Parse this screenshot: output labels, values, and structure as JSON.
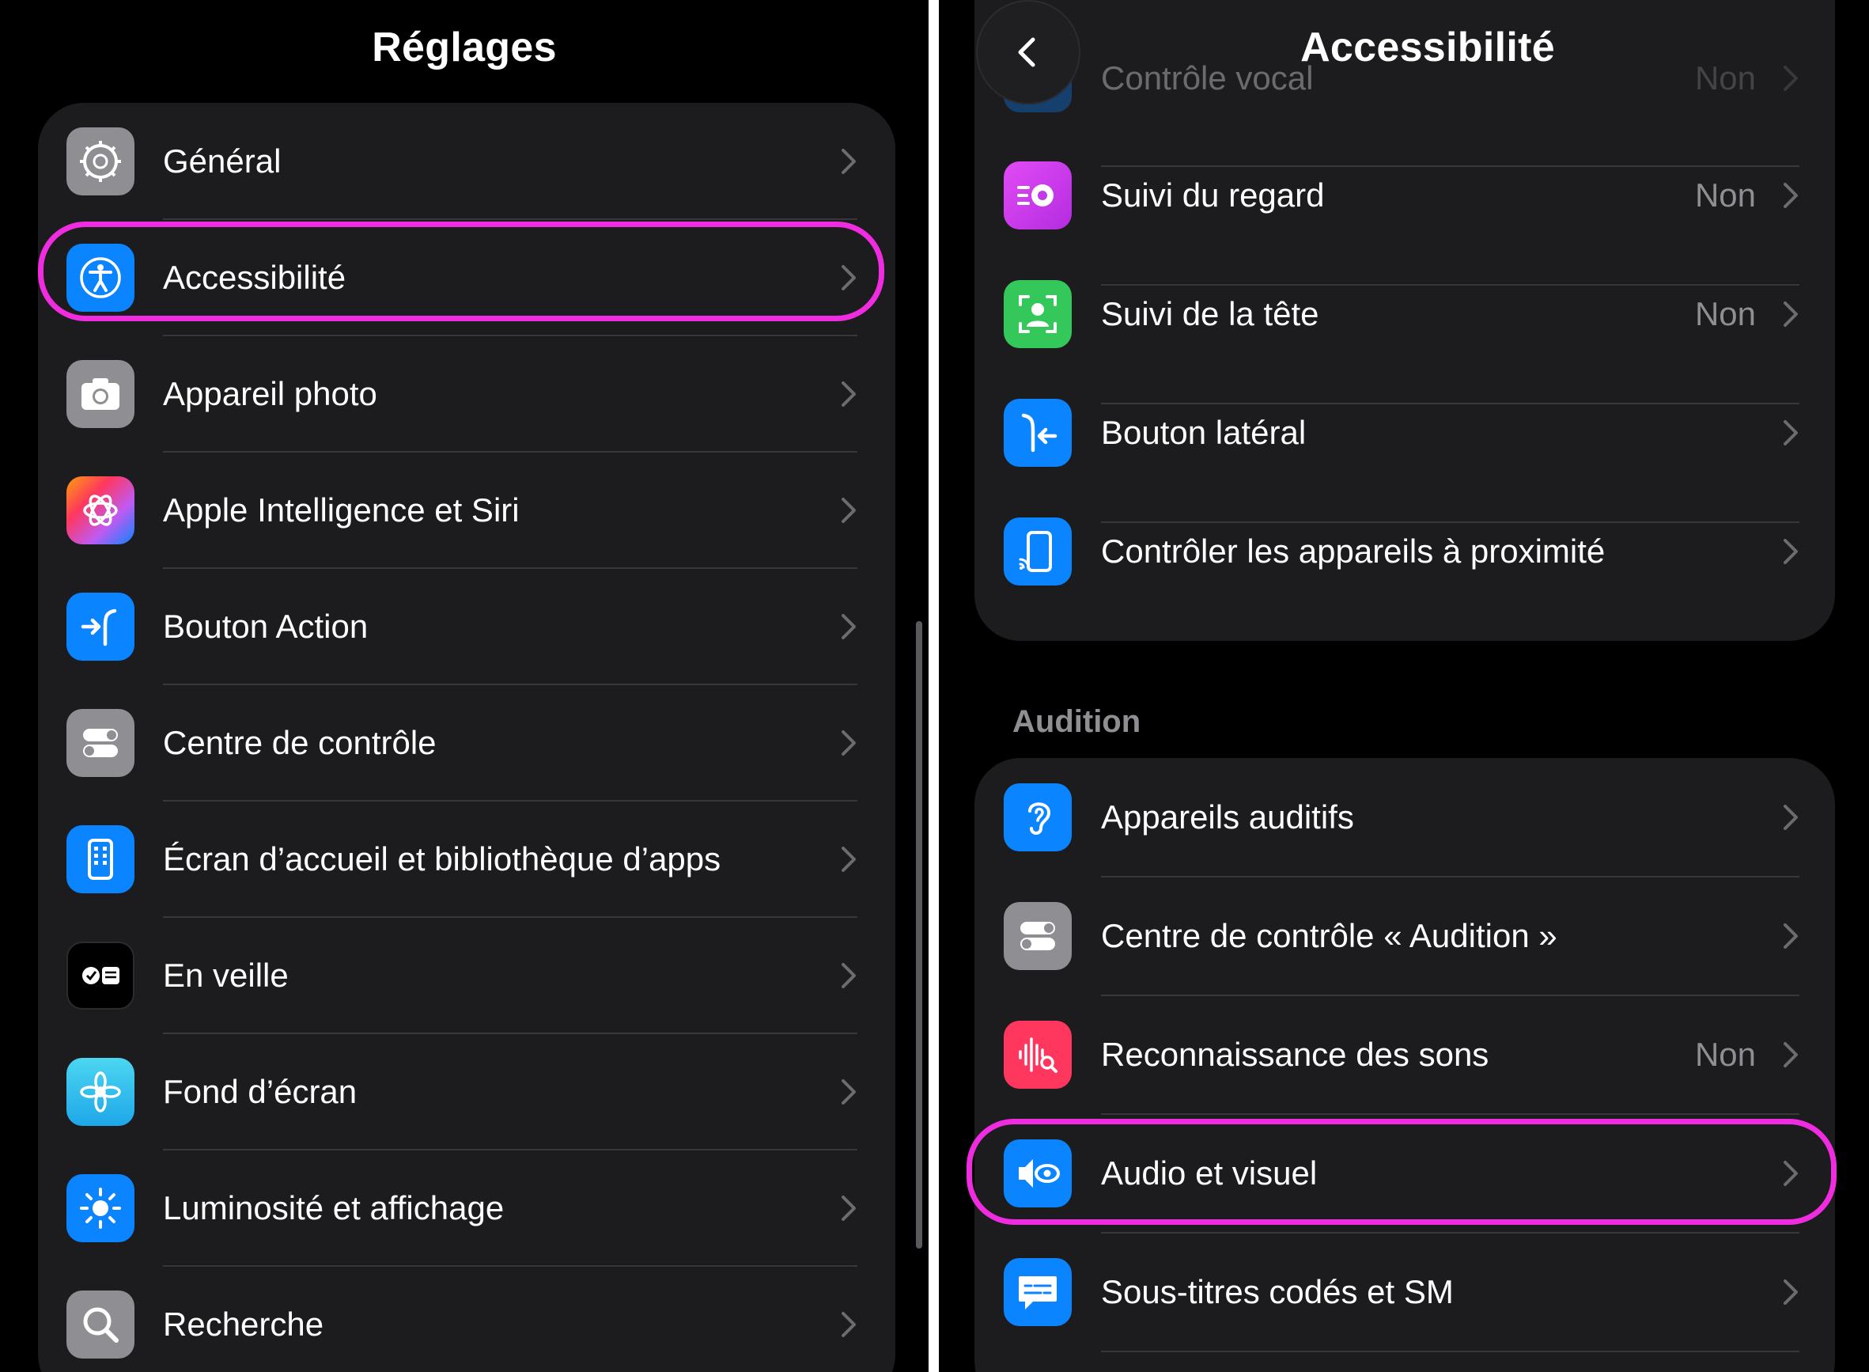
{
  "left": {
    "title": "Réglages",
    "items": [
      {
        "label": "Général",
        "icon": "gear-icon",
        "color": "#8e8e93"
      },
      {
        "label": "Accessibilité",
        "icon": "accessibility-icon",
        "color": "#0a84ff"
      },
      {
        "label": "Appareil photo",
        "icon": "camera-icon",
        "color": "#8e8e93"
      },
      {
        "label": "Apple Intelligence et Siri",
        "icon": "apple-intelligence-icon",
        "color": "#ff6b6b"
      },
      {
        "label": "Bouton Action",
        "icon": "action-button-icon",
        "color": "#0a84ff"
      },
      {
        "label": "Centre de contrôle",
        "icon": "control-center-icon",
        "color": "#8e8e93"
      },
      {
        "label": "Écran d’accueil et bibliothèque d’apps",
        "icon": "home-screen-icon",
        "color": "#0a84ff"
      },
      {
        "label": "En veille",
        "icon": "standby-icon",
        "color": "#000000"
      },
      {
        "label": "Fond d’écran",
        "icon": "wallpaper-icon",
        "color": "#32ade6"
      },
      {
        "label": "Luminosité et affichage",
        "icon": "brightness-icon",
        "color": "#0a84ff"
      },
      {
        "label": "Recherche",
        "icon": "search-icon",
        "color": "#8e8e93"
      }
    ]
  },
  "right": {
    "title": "Accessibilité",
    "back_label": "Retour",
    "group1": [
      {
        "label": "Contrôle vocal",
        "value": "Non",
        "icon": "voice-control-icon",
        "color": "#0a84ff"
      },
      {
        "label": "Suivi du regard",
        "value": "Non",
        "icon": "eye-tracking-icon",
        "color": "#d63ff0"
      },
      {
        "label": "Suivi de la tête",
        "value": "Non",
        "icon": "head-tracking-icon",
        "color": "#34c759"
      },
      {
        "label": "Bouton latéral",
        "value": "",
        "icon": "side-button-icon",
        "color": "#0a84ff"
      },
      {
        "label": "Contrôler les appareils à proximité",
        "value": "",
        "icon": "nearby-devices-icon",
        "color": "#0a84ff"
      }
    ],
    "section_header": "Audition",
    "group2": [
      {
        "label": "Appareils auditifs",
        "value": "",
        "icon": "ear-icon",
        "color": "#0a84ff"
      },
      {
        "label": "Centre de contrôle « Audition »",
        "value": "",
        "icon": "control-center-icon",
        "color": "#8e8e93"
      },
      {
        "label": "Reconnaissance des sons",
        "value": "Non",
        "icon": "sound-recognition-icon",
        "color": "#ff375f"
      },
      {
        "label": "Audio et visuel",
        "value": "",
        "icon": "audio-visual-icon",
        "color": "#0a84ff"
      },
      {
        "label": "Sous-titres codés et SM",
        "value": "",
        "icon": "subtitles-icon",
        "color": "#0a84ff"
      }
    ]
  },
  "colors": {
    "highlight": "#f02ce0",
    "group_background": "#1c1c1e",
    "secondary_text": "#8e8e93"
  }
}
